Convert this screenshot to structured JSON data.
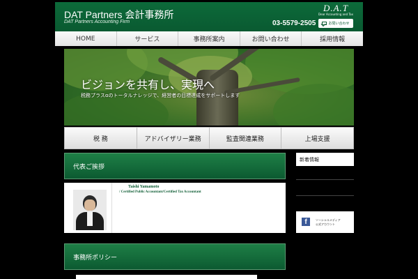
{
  "header": {
    "title": "DAT Partners 会計事務所",
    "subtitle": "DAT Partners Accounting Firm",
    "logo_main": "D.A.T",
    "logo_tagline": "Dear Accounting and Tax",
    "phone": "03-5579-2505",
    "contact_label": "お問い合わせ"
  },
  "nav": {
    "items": [
      "HOME",
      "サービス",
      "事務所案内",
      "お問い合わせ",
      "採用情報"
    ]
  },
  "hero": {
    "title": "ビジョンを共有し、実現へ",
    "subtitle": "税務プラスαのトータルナレッジで、経営者の目標達成をサポートします"
  },
  "services": {
    "items": [
      "税 務",
      "アドバイザリー業務",
      "監査関連業務",
      "上場支援"
    ]
  },
  "representative": {
    "heading": "代表ご挨拶",
    "name": "Taishi Yamamoto",
    "credential": "/ Certified Public Accountant/Certified Tax Accountant"
  },
  "policy": {
    "heading": "事務所ポリシー"
  },
  "sidebar": {
    "news_heading": "新着情報",
    "social_line1": "ソーシャルメディア",
    "social_line2": "公式アカウント",
    "facebook_glyph": "f"
  },
  "colors": {
    "brand_green": "#0c5a31",
    "header_green": "#0c6a3a",
    "facebook_blue": "#3b5998"
  }
}
